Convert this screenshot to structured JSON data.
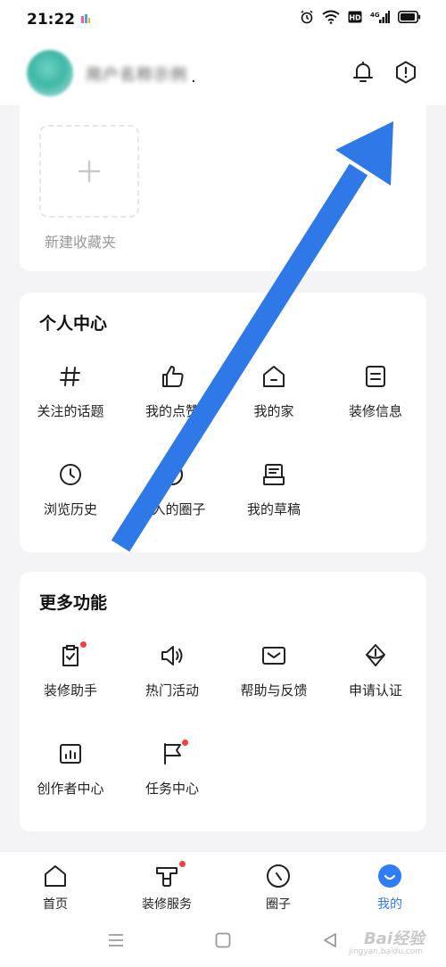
{
  "status_bar": {
    "time": "21:22"
  },
  "header": {
    "username": "用户名称示例",
    "username_suffix": ".",
    "bell_icon": "bell-icon",
    "info_icon": "hexagon-info-icon"
  },
  "favorites": {
    "new_folder_label": "新建收藏夹"
  },
  "personal_center": {
    "title": "个人中心",
    "items": [
      {
        "label": "关注的话题",
        "icon": "hash-icon"
      },
      {
        "label": "我的点赞",
        "icon": "thumbs-up-icon"
      },
      {
        "label": "我的家",
        "icon": "home-icon"
      },
      {
        "label": "装修信息",
        "icon": "document-icon"
      },
      {
        "label": "浏览历史",
        "icon": "clock-icon"
      },
      {
        "label": "加入的圈子",
        "icon": "circle-group-icon"
      },
      {
        "label": "我的草稿",
        "icon": "draft-icon"
      }
    ]
  },
  "more_features": {
    "title": "更多功能",
    "items": [
      {
        "label": "装修助手",
        "icon": "clipboard-check-icon",
        "badge": true
      },
      {
        "label": "热门活动",
        "icon": "speaker-icon",
        "badge": false
      },
      {
        "label": "帮助与反馈",
        "icon": "mail-icon",
        "badge": false
      },
      {
        "label": "申请认证",
        "icon": "badge-icon",
        "badge": false
      },
      {
        "label": "创作者中心",
        "icon": "stats-icon",
        "badge": false
      },
      {
        "label": "任务中心",
        "icon": "flag-icon",
        "badge": true
      }
    ]
  },
  "bottom_nav": {
    "items": [
      {
        "label": "首页",
        "icon": "home-icon"
      },
      {
        "label": "装修服务",
        "icon": "service-icon"
      },
      {
        "label": "圈子",
        "icon": "circle-icon"
      },
      {
        "label": "我的",
        "icon": "smile-icon",
        "active": true
      }
    ]
  },
  "watermark": {
    "text": "Bai经验",
    "sub": "jingyan.baidu.com"
  },
  "colors": {
    "accent": "#2e7cf6",
    "arrow": "#2f78e8",
    "badge": "#f04040"
  }
}
